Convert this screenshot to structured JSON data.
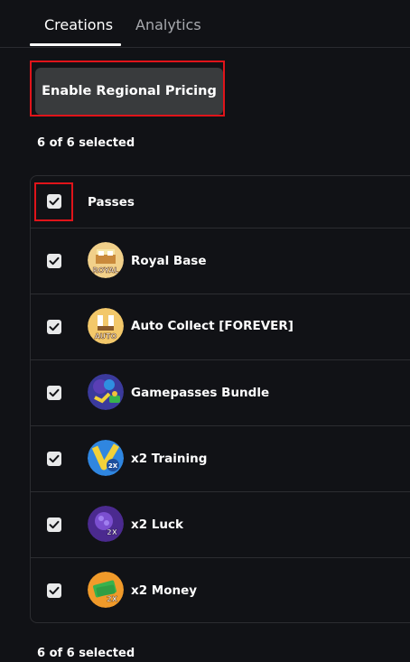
{
  "tabs": [
    {
      "label": "Creations",
      "active": true
    },
    {
      "label": "Analytics",
      "active": false
    }
  ],
  "toolbar": {
    "regional_pricing_label": "Enable Regional Pricing"
  },
  "selection": {
    "top_text": "6 of 6 selected",
    "bottom_text": "6 of 6 selected"
  },
  "table": {
    "header_label": "Passes",
    "header_checked": true,
    "items": [
      {
        "name": "Royal Base",
        "checked": true,
        "icon": "royal-base-icon"
      },
      {
        "name": "Auto Collect [FOREVER]",
        "checked": true,
        "icon": "auto-collect-icon"
      },
      {
        "name": "Gamepasses Bundle",
        "checked": true,
        "icon": "gamepasses-bundle-icon"
      },
      {
        "name": "x2 Training",
        "checked": true,
        "icon": "x2-training-icon"
      },
      {
        "name": "x2 Luck",
        "checked": true,
        "icon": "x2-luck-icon"
      },
      {
        "name": "x2 Money",
        "checked": true,
        "icon": "x2-money-icon"
      }
    ]
  },
  "thumb_text": {
    "royal": "ROYAL",
    "auto": "AUTO",
    "x2": "2X"
  },
  "colors": {
    "background": "#111216",
    "highlight_outline": "#e0141a",
    "button_bg": "#393b3d",
    "divider": "#2c2d31"
  }
}
